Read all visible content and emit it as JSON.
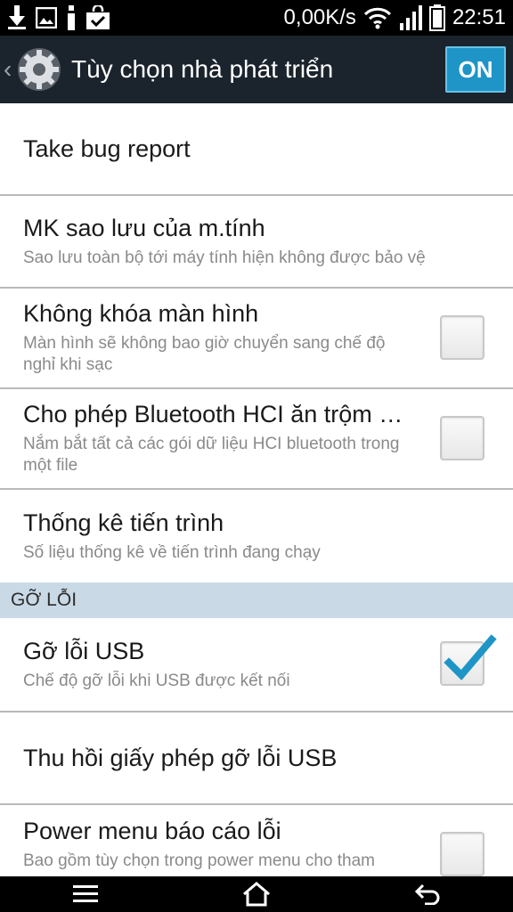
{
  "status_bar": {
    "left_icons": [
      "download-icon",
      "image-icon",
      "info-icon",
      "bag-check-icon"
    ],
    "network_speed": "0,00K/s",
    "right_icons": [
      "wifi-icon",
      "signal-icon",
      "battery-icon"
    ],
    "time": "22:51"
  },
  "action_bar": {
    "back_glyph": "‹",
    "icon": "settings-gear-icon",
    "title": "Tùy chọn nhà phát triển",
    "switch_label": "ON",
    "switch_color": "#1e95c6"
  },
  "items": [
    {
      "title": "Take bug report",
      "subtitle": "",
      "checkbox": null
    },
    {
      "title": "MK sao lưu của m.tính",
      "subtitle": "Sao lưu toàn bộ tới máy tính hiện không được bảo vệ",
      "checkbox": null
    },
    {
      "title": "Không khóa màn hình",
      "subtitle": "Màn hình sẽ không bao giờ chuyển sang chế độ nghỉ khi sạc",
      "checkbox": false
    },
    {
      "title": "Cho phép Bluetooth HCI ăn trộm …",
      "subtitle": "Nắm bắt tất cả các gói dữ liệu HCI bluetooth trong một file",
      "checkbox": false
    },
    {
      "title": "Thống kê tiến trình",
      "subtitle": "Số liệu thống kê về tiến trình đang chạy",
      "checkbox": null
    }
  ],
  "section": {
    "label": "GỠ LỖI"
  },
  "debug_items": [
    {
      "title": "Gỡ lỗi USB",
      "subtitle": "Chế độ gỡ lỗi khi USB được kết nối",
      "checkbox": true
    },
    {
      "title": "Thu hồi giấy phép gỡ lỗi USB",
      "subtitle": "",
      "checkbox": null
    },
    {
      "title": "Power menu báo cáo lỗi",
      "subtitle": "Bao gồm tùy chọn trong power menu cho tham",
      "checkbox": false
    }
  ],
  "nav_bar": {
    "buttons": [
      "menu-icon",
      "home-icon",
      "back-icon"
    ]
  },
  "colors": {
    "accent": "#1e95c6",
    "section_bg": "#c9d9e6",
    "check": "#1e95c6"
  }
}
